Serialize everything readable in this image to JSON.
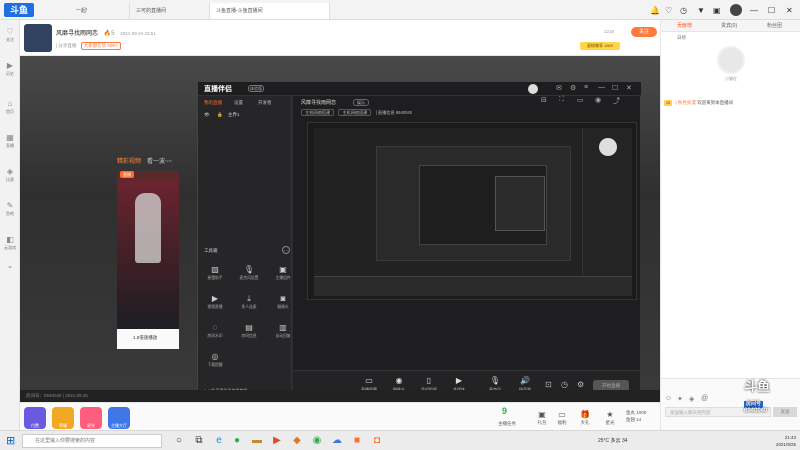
{
  "browser": {
    "logo": "斗鱼",
    "tabs": [
      "一起!",
      "三可的直播间",
      "斗鱼直播-斗鱼直播间"
    ],
    "right_icons": [
      "bell-icon",
      "heart-icon",
      "history-icon",
      "shirt-icon",
      "box-icon",
      "avatar-icon",
      "minimize-icon",
      "maximize-icon",
      "close-icon"
    ]
  },
  "rail": {
    "items": [
      {
        "icon": "heart-icon",
        "label": "关注"
      },
      {
        "icon": "play-icon",
        "label": "历史"
      },
      {
        "icon": "home-icon",
        "label": "首页"
      },
      {
        "icon": "grid-icon",
        "label": "直播"
      },
      {
        "icon": "match-icon",
        "label": "比赛"
      },
      {
        "icon": "pencil-icon",
        "label": "鱼吧"
      },
      {
        "icon": "shop-icon",
        "label": "云游戏"
      }
    ]
  },
  "room": {
    "title": "风靡寻找雨网恋",
    "hot": "5",
    "date": "2021-09-24 23:51",
    "tag1": "| 分享直播",
    "tag2": "大家都在玩 500+",
    "follow": "关注",
    "follow_count": "1216",
    "badge": "星粉尊享 1800"
  },
  "stream": {
    "hint_orange": "精彩视频",
    "hint_gray": "看一波~~",
    "live_tag": "直播",
    "video_caption": "1.5倍速播放"
  },
  "companion": {
    "brand": "直播伴侣",
    "badge": "体验版",
    "left_tabs": [
      "我的直播",
      "设置",
      "开发者"
    ],
    "scene_label": "主界1",
    "tools_title": "工具箱",
    "tools": [
      "摇摆助手",
      "麦克风设置",
      "主播组件",
      "视频直播",
      "多人连麦",
      "摄像头",
      "房间水印",
      "房间信息",
      "自动回复",
      "下载提醒"
    ],
    "footer": "斗鱼直播伴侣使用教程",
    "stream_title": "风靡寻找雨网恋",
    "stream_badge": "娱乐",
    "crumbs": [
      "主机网络搭建",
      "主机网络搭建"
    ],
    "crumb_text": "| 直播信息  6940040",
    "controls": [
      "直播屏幕",
      "摄像头",
      "手机投屏",
      "多媒体",
      "麦克风",
      "扬声器"
    ],
    "start": "开始直播"
  },
  "player": {
    "room_info": "房间号：6940040  |  2021.09.25"
  },
  "gifts": {
    "items": [
      {
        "label": "付费",
        "color": "#6a5ae0"
      },
      {
        "label": "荣耀",
        "color": "#f1a823"
      },
      {
        "label": "星光",
        "color": "#ff5d7d"
      },
      {
        "label": "主播大厅",
        "color": "#3f76e8"
      }
    ],
    "right": [
      {
        "icon": "bag-icon",
        "label": "主播任务",
        "count": "9"
      },
      {
        "icon": "box-icon",
        "label": "礼包"
      },
      {
        "icon": "ticket-icon",
        "label": "福利"
      },
      {
        "icon": "gift-icon",
        "label": "大礼"
      },
      {
        "icon": "star-icon",
        "label": "星光"
      }
    ],
    "coins_label": "鱼丸",
    "coins": "1000",
    "yuchi_label": "鱼翅",
    "yuchi": "14"
  },
  "right_panel": {
    "tabs": [
      "贡献榜",
      "贵宾(0)",
      "粉丝团"
    ],
    "sub": "日榜",
    "host_name": "小猫在",
    "chat": {
      "level": "25",
      "nick": "| 秋色弥漫",
      "text": "欢迎来到本直播间"
    },
    "input_placeholder": "发送输入聊天吧内容",
    "send": "发送",
    "watermark": "斗鱼",
    "watermark_sub": "房间号",
    "room_no": "6940040",
    "bottom_icons": [
      "emoji-icon",
      "bulb-icon",
      "fans-icon",
      "at-icon"
    ]
  },
  "taskbar": {
    "search_placeholder": "在这里输入你要搜索的内容",
    "weather": "25°C 多云  34",
    "time": "21:43",
    "date": "2021/9/25",
    "apps": [
      "cortana-icon",
      "taskview-icon",
      "edge-icon",
      "folder-icon",
      "chrome-icon",
      "media-icon",
      "games-icon",
      "app-icon",
      "wechat-icon",
      "cloud-icon",
      "douyu-icon"
    ]
  },
  "colors": {
    "accent": "#ff7a3d",
    "brand_blue": "#1f6fe0"
  }
}
